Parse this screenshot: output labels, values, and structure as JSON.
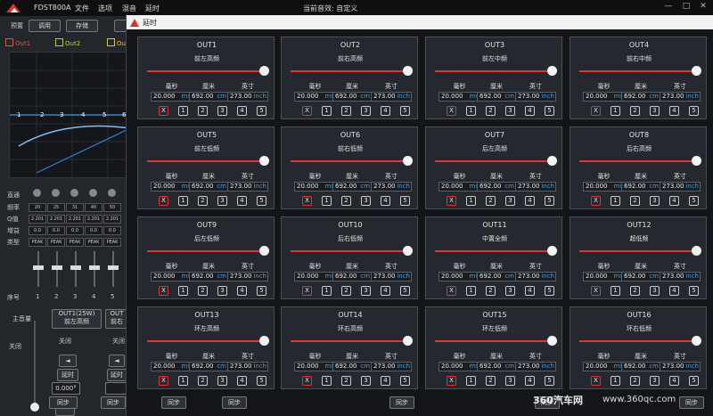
{
  "app": {
    "model": "FDST800A",
    "menu": [
      "文件",
      "选项",
      "混音",
      "延时"
    ],
    "current_effect": "当前音效: 自定义"
  },
  "toolbar": {
    "preset_label": "预置",
    "call_label": "调用",
    "save_label": "存储"
  },
  "checkboxes": [
    {
      "label": "Out1",
      "color": "#e05050"
    },
    {
      "label": "Out2",
      "color": "#b8d040"
    },
    {
      "label": "Out",
      "color": "#e0c040"
    }
  ],
  "eq_markers": [
    "1",
    "2",
    "3",
    "4",
    "5",
    "6"
  ],
  "eq_rows": {
    "labels": [
      "直通",
      "频率",
      "Q值",
      "增益",
      "类型"
    ],
    "freq": [
      "20",
      "25",
      "31",
      "40",
      "50"
    ],
    "q": [
      "2.201",
      "2.201",
      "2.201",
      "2.201",
      "2.201"
    ],
    "gain": [
      "0.0",
      "0.0",
      "0.0",
      "0.0",
      "0.0"
    ],
    "type": [
      "PEAK",
      "PEAK",
      "PEAK",
      "PEAK",
      "PEAK"
    ]
  },
  "seq": {
    "label": "序号",
    "numbers": [
      "1",
      "2",
      "3",
      "4",
      "5"
    ]
  },
  "bottom_left": {
    "master_label": "主音量",
    "off_label": "关闭",
    "out_btn": "OUT1(25W)",
    "out_sub": "前左高频",
    "out_btn2": "OUT",
    "out_sub2": "前右",
    "close2": "关闭",
    "delay_btn": "延时",
    "delay_value": "0.000°",
    "sync_labels": [
      "同步",
      "同步",
      "同步",
      "同步",
      "同步",
      "同步",
      "同步"
    ]
  },
  "dialog": {
    "title": "延时",
    "unit_headers": [
      "毫秒",
      "厘米",
      "英寸"
    ],
    "units": [
      "ms",
      "cm",
      "inch"
    ],
    "buttons": [
      "X",
      "1",
      "2",
      "3",
      "4",
      "5"
    ],
    "panels": [
      {
        "name": "OUT1",
        "sub": "前左高频",
        "ms": "20.000",
        "cm": "692.00",
        "inch": "273.00"
      },
      {
        "name": "OUT2",
        "sub": "前右高频",
        "ms": "20.000",
        "cm": "692.00",
        "inch": "273.00"
      },
      {
        "name": "OUT3",
        "sub": "前左中频",
        "ms": "20.000",
        "cm": "692.00",
        "inch": "273.00"
      },
      {
        "name": "OUT4",
        "sub": "前右中频",
        "ms": "20.000",
        "cm": "692.00",
        "inch": "273.00"
      },
      {
        "name": "OUT5",
        "sub": "前左低频",
        "ms": "20.000",
        "cm": "692.00",
        "inch": "273.00"
      },
      {
        "name": "OUT6",
        "sub": "前右低频",
        "ms": "20.000",
        "cm": "692.00",
        "inch": "273.00"
      },
      {
        "name": "OUT7",
        "sub": "后左高频",
        "ms": "20.000",
        "cm": "692.00",
        "inch": "273.00"
      },
      {
        "name": "OUT8",
        "sub": "后右高频",
        "ms": "20.000",
        "cm": "692.00",
        "inch": "273.00"
      },
      {
        "name": "OUT9",
        "sub": "后左低频",
        "ms": "20.000",
        "cm": "692.00",
        "inch": "273.00"
      },
      {
        "name": "OUT10",
        "sub": "后右低频",
        "ms": "20.000",
        "cm": "692.00",
        "inch": "273.00"
      },
      {
        "name": "OUT11",
        "sub": "中置全频",
        "ms": "20.000",
        "cm": "692.00",
        "inch": "273.00"
      },
      {
        "name": "OUT12",
        "sub": "超低频",
        "ms": "20.000",
        "cm": "692.00",
        "inch": "273.00"
      },
      {
        "name": "OUT13",
        "sub": "环左高频",
        "ms": "20.000",
        "cm": "692.00",
        "inch": "273.00"
      },
      {
        "name": "OUT14",
        "sub": "环右高频",
        "ms": "20.000",
        "cm": "692.00",
        "inch": "273.00"
      },
      {
        "name": "OUT15",
        "sub": "环左低频",
        "ms": "20.000",
        "cm": "692.00",
        "inch": "273.00"
      },
      {
        "name": "OUT16",
        "sub": "环右低频",
        "ms": "20.000",
        "cm": "692.00",
        "inch": "273.00"
      }
    ]
  },
  "watermark": {
    "brand": "360汽车网",
    "url": "www.360qc.com"
  },
  "colors": {
    "accent_red": "#d93a34",
    "unit_blue": "#4b9bd8"
  }
}
